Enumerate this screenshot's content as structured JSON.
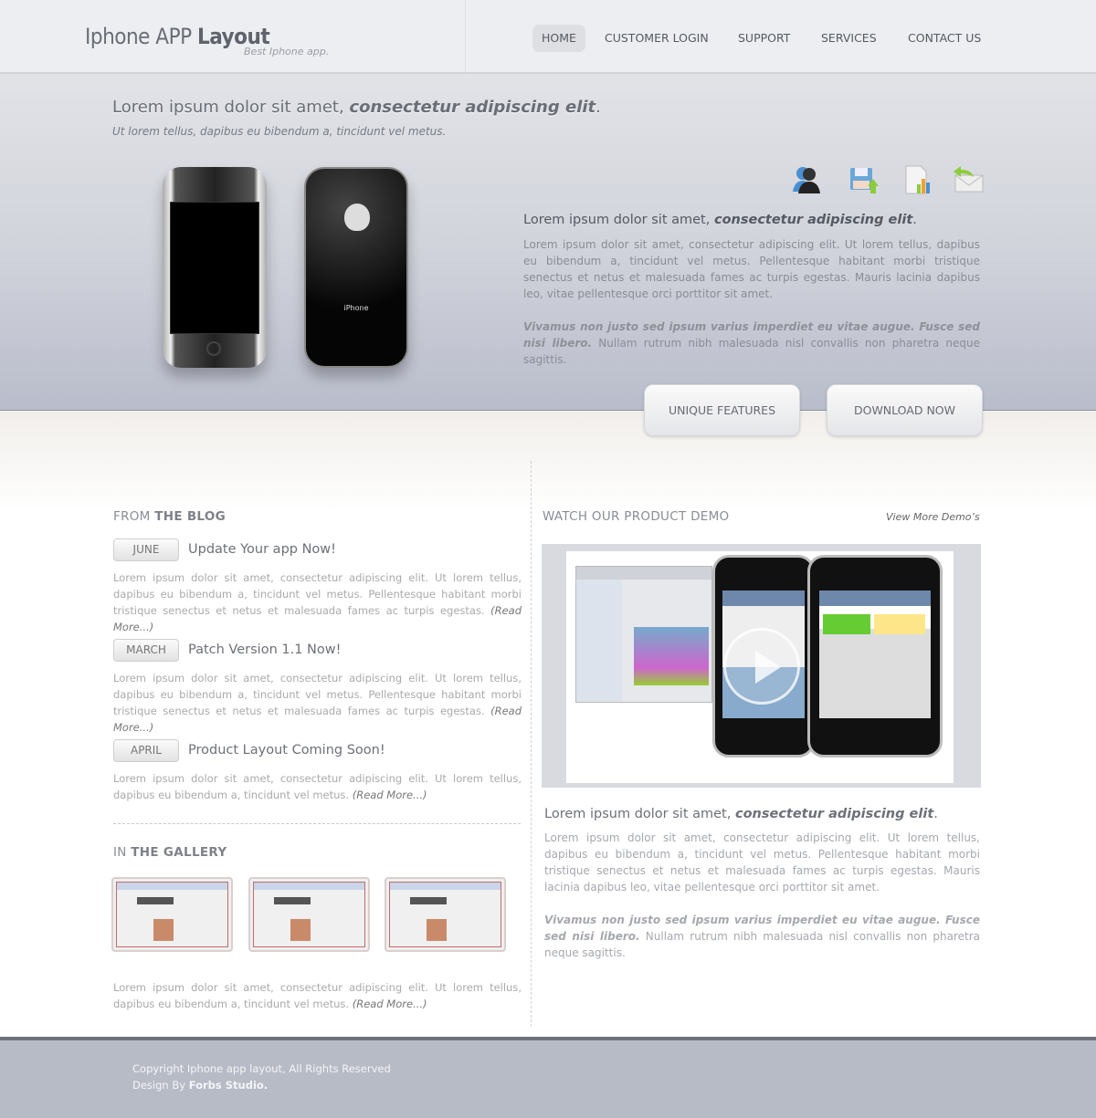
{
  "header": {
    "logo_light": "Iphone APP ",
    "logo_bold": "Layout",
    "tagline": "Best Iphone app.",
    "nav": [
      {
        "label": "HOME",
        "active": true
      },
      {
        "label": "CUSTOMER LOGIN"
      },
      {
        "label": "SUPPORT"
      },
      {
        "label": "SERVICES"
      },
      {
        "label": "CONTACT US"
      }
    ]
  },
  "hero": {
    "title_plain": "Lorem ipsum dolor sit amet, ",
    "title_em": "consectetur adipiscing elit",
    "title_end": ".",
    "subtitle": "Ut lorem tellus, dapibus eu bibendum a, tincidunt vel metus.",
    "phone_label": "iPhone",
    "icons": [
      "user-icon",
      "save-upload-icon",
      "report-chart-icon",
      "mail-reply-icon"
    ],
    "right_title_plain": "Lorem ipsum dolor sit amet, ",
    "right_title_em": "consectetur adipiscing elit",
    "right_title_end": ".",
    "para1": "Lorem ipsum dolor sit amet, consectetur adipiscing elit. Ut lorem tellus, dapibus eu bibendum a, tincidunt vel metus. Pellentesque habitant morbi tristique senectus et netus et malesuada fames ac turpis egestas. Mauris lacinia dapibus leo, vitae pellentesque orci porttitor sit amet.",
    "para2_em": "Vivamus non justo sed ipsum varius imperdiet eu vitae augue. Fusce sed nisi libero.",
    "para2_rest": " Nullam rutrum nibh malesuada nisl convallis non pharetra neque sagittis.",
    "buttons": {
      "features": "UNIQUE FEATURES",
      "download": "DOWNLOAD NOW"
    }
  },
  "blog": {
    "heading_light": "FROM ",
    "heading_bold": "THE BLOG",
    "posts": [
      {
        "month": "JUNE",
        "title": "Update Your app Now!",
        "text": "Lorem ipsum dolor sit amet, consectetur adipiscing elit. Ut lorem tellus, dapibus eu bibendum a, tincidunt vel metus. Pellentesque habitant morbi tristique senectus et netus et malesuada fames ac turpis egestas. ",
        "more": "(Read More...)"
      },
      {
        "month": "MARCH",
        "title": "Patch Version 1.1 Now!",
        "text": "Lorem ipsum dolor sit amet, consectetur adipiscing elit. Ut lorem tellus, dapibus eu bibendum a, tincidunt vel metus. Pellentesque habitant morbi tristique senectus et netus et malesuada fames ac turpis egestas. ",
        "more": "(Read More...)"
      },
      {
        "month": "APRIL",
        "title": "Product Layout Coming Soon!",
        "text": "Lorem ipsum dolor sit amet, consectetur adipiscing elit. Ut lorem tellus, dapibus eu bibendum a, tincidunt vel metus. ",
        "more": "(Read More...)"
      }
    ]
  },
  "gallery": {
    "heading_light": "IN ",
    "heading_bold": "THE GALLERY",
    "text": "Lorem ipsum dolor sit amet, consectetur adipiscing elit. Ut lorem tellus, dapibus eu bibendum a, tincidunt vel metus. ",
    "more": "(Read More...)"
  },
  "demo": {
    "heading": "WATCH OUR PRODUCT DEMO",
    "view_more": "View More Demo’s",
    "title_plain": "Lorem ipsum dolor sit amet, ",
    "title_em": "consectetur adipiscing elit",
    "title_end": ".",
    "para1": "Lorem ipsum dolor sit amet, consectetur adipiscing elit. Ut lorem tellus, dapibus eu bibendum a, tincidunt vel metus. Pellentesque habitant morbi tristique senectus et netus et malesuada fames ac turpis egestas. Mauris lacinia dapibus leo, vitae pellentesque orci porttitor sit amet.",
    "para2_em": "Vivamus non justo sed ipsum varius imperdiet eu vitae augue. Fusce sed nisi libero.",
    "para2_rest": " Nullam rutrum nibh malesuada nisl convallis non pharetra neque sagittis."
  },
  "footer": {
    "copyright": "Copyright Iphone app layout, All Rights Reserved",
    "design_by": "Design By ",
    "studio": "Forbs Studio."
  }
}
